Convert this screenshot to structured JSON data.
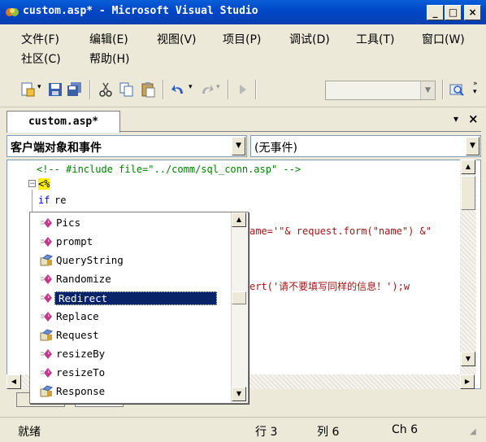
{
  "window": {
    "title": "custom.asp* - Microsoft Visual Studio",
    "minimize": "_",
    "maximize": "□",
    "close": "×"
  },
  "menu": {
    "row1": [
      "文件(F)",
      "编辑(E)",
      "视图(V)",
      "项目(P)",
      "调试(D)",
      "工具(T)",
      "窗口(W)"
    ],
    "row2": [
      "社区(C)",
      "帮助(H)"
    ]
  },
  "doc_tabs": {
    "active": "custom.asp*",
    "dropdown": "▾",
    "close": "×"
  },
  "object_combo": {
    "value": "客户端对象和事件"
  },
  "event_combo": {
    "value": "(无事件)"
  },
  "code": {
    "line1": "<!-- #include file=\"../comm/sql_conn.asp\" -->",
    "line2": "<%",
    "line3_kw": "if",
    "line3_rest": " re",
    "line4_tail": "ame='\"& request.form(\"name\") &\"",
    "line5_tail": "ert('请不要填写同样的信息！');w"
  },
  "completion": {
    "items": [
      {
        "label": "Pics",
        "icon": "method-icon"
      },
      {
        "label": "prompt",
        "icon": "method-icon"
      },
      {
        "label": "QueryString",
        "icon": "property-icon"
      },
      {
        "label": "Randomize",
        "icon": "method-icon"
      },
      {
        "label": "Redirect",
        "icon": "method-icon",
        "selected": true
      },
      {
        "label": "Replace",
        "icon": "method-icon"
      },
      {
        "label": "Request",
        "icon": "property-icon"
      },
      {
        "label": "resizeBy",
        "icon": "method-icon"
      },
      {
        "label": "resizeTo",
        "icon": "method-icon"
      },
      {
        "label": "Response",
        "icon": "property-icon"
      }
    ]
  },
  "status": {
    "ready": "就绪",
    "line": "行 3",
    "col": "列 6",
    "ch": "Ch 6"
  },
  "colors": {
    "title_bar": "#0a4fd0",
    "selection": "#0a246a",
    "method_icon": "#c23a8a",
    "keyword": "#0000ff",
    "comment": "#008000",
    "string": "#a31515"
  }
}
